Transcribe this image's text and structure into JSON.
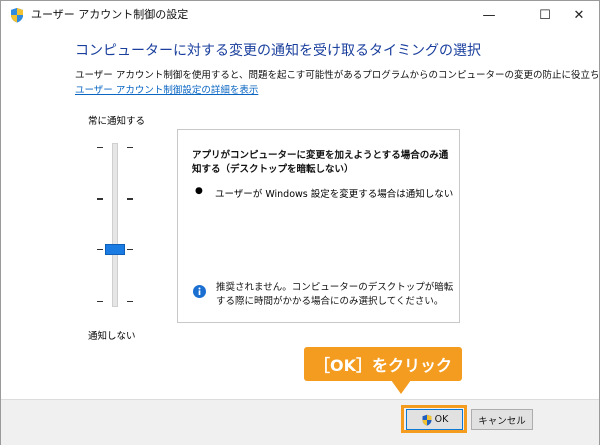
{
  "window": {
    "title": "ユーザー アカウント制御の設定",
    "minimize_glyph": "—",
    "maximize_glyph": "☐",
    "close_glyph": "✕"
  },
  "main": {
    "heading": "コンピューターに対する変更の通知を受け取るタイミングの選択",
    "description": "ユーザー アカウント制御を使用すると、問題を起こす可能性があるプログラムからのコンピューターの変更の防止に役立ちます。",
    "details_link": "ユーザー アカウント制御設定の詳細を表示"
  },
  "slider": {
    "top_label": "常に通知する",
    "bottom_label": "通知しない",
    "levels": 4,
    "selected_level": 2
  },
  "panel": {
    "title": "アプリがコンピューターに変更を加えようとする場合のみ通知する（デスクトップを暗転しない）",
    "bullet": "●",
    "bullet_text": "ユーザーが Windows 設定を変更する場合は通知しない",
    "info_text": "推奨されません。コンピューターのデスクトップが暗転する際に時間がかかる場合にのみ選択してください。"
  },
  "annotation": {
    "callout": "［OK］をクリック"
  },
  "buttons": {
    "ok_label": "OK",
    "cancel_label": "キャンセル"
  },
  "colors": {
    "heading": "#1a3f9d",
    "link": "#0a66c2",
    "accent": "#1a7ce3",
    "callout": "#f39c1f"
  },
  "icons": {
    "title": "uac-shield-icon",
    "info": "info-icon",
    "ok_button": "uac-shield-icon"
  }
}
